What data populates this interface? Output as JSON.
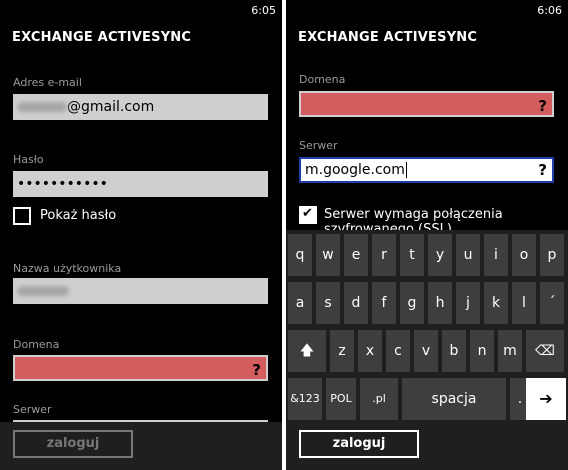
{
  "left": {
    "clock": "6:05",
    "title": "EXCHANGE ACTIVESYNC",
    "email_label": "Adres e-mail",
    "email_suffix": "@gmail.com",
    "password_label": "Hasło",
    "password_value": "•••••••••••",
    "show_password_label": "Pokaż hasło",
    "username_label": "Nazwa użytkownika",
    "domain_label": "Domena",
    "domain_marker": "?",
    "server_label": "Serwer",
    "login_button": "zaloguj"
  },
  "right": {
    "clock": "6:06",
    "title": "EXCHANGE ACTIVESYNC",
    "domain_label": "Domena",
    "domain_marker": "?",
    "server_label": "Serwer",
    "server_value": "m.google.com",
    "server_marker": "?",
    "ssl_label": "Serwer wymaga połączenia",
    "ssl_label_cut": "szyfrowanego (SSL)",
    "login_button": "zaloguj"
  },
  "keyboard": {
    "row1": [
      "q",
      "w",
      "e",
      "r",
      "t",
      "y",
      "u",
      "i",
      "o",
      "p"
    ],
    "row2": [
      "a",
      "s",
      "d",
      "f",
      "g",
      "h",
      "j",
      "k",
      "l",
      "´"
    ],
    "row3": [
      "z",
      "x",
      "c",
      "v",
      "b",
      "n",
      "m"
    ],
    "shift": "🡅",
    "backspace": "⌫",
    "sym": "&123",
    "lang": "POL",
    "domain": ".pl",
    "space": "spacja",
    "dot": ".",
    "enter": "➔"
  },
  "colors": {
    "error_field": "#d35c5c",
    "focus_border": "#1f3fa8"
  },
  "icons": {
    "checkbox_checked": "checkmark-icon",
    "enter": "arrow-right-icon",
    "backspace": "backspace-icon",
    "shift": "shift-arrow-icon"
  }
}
